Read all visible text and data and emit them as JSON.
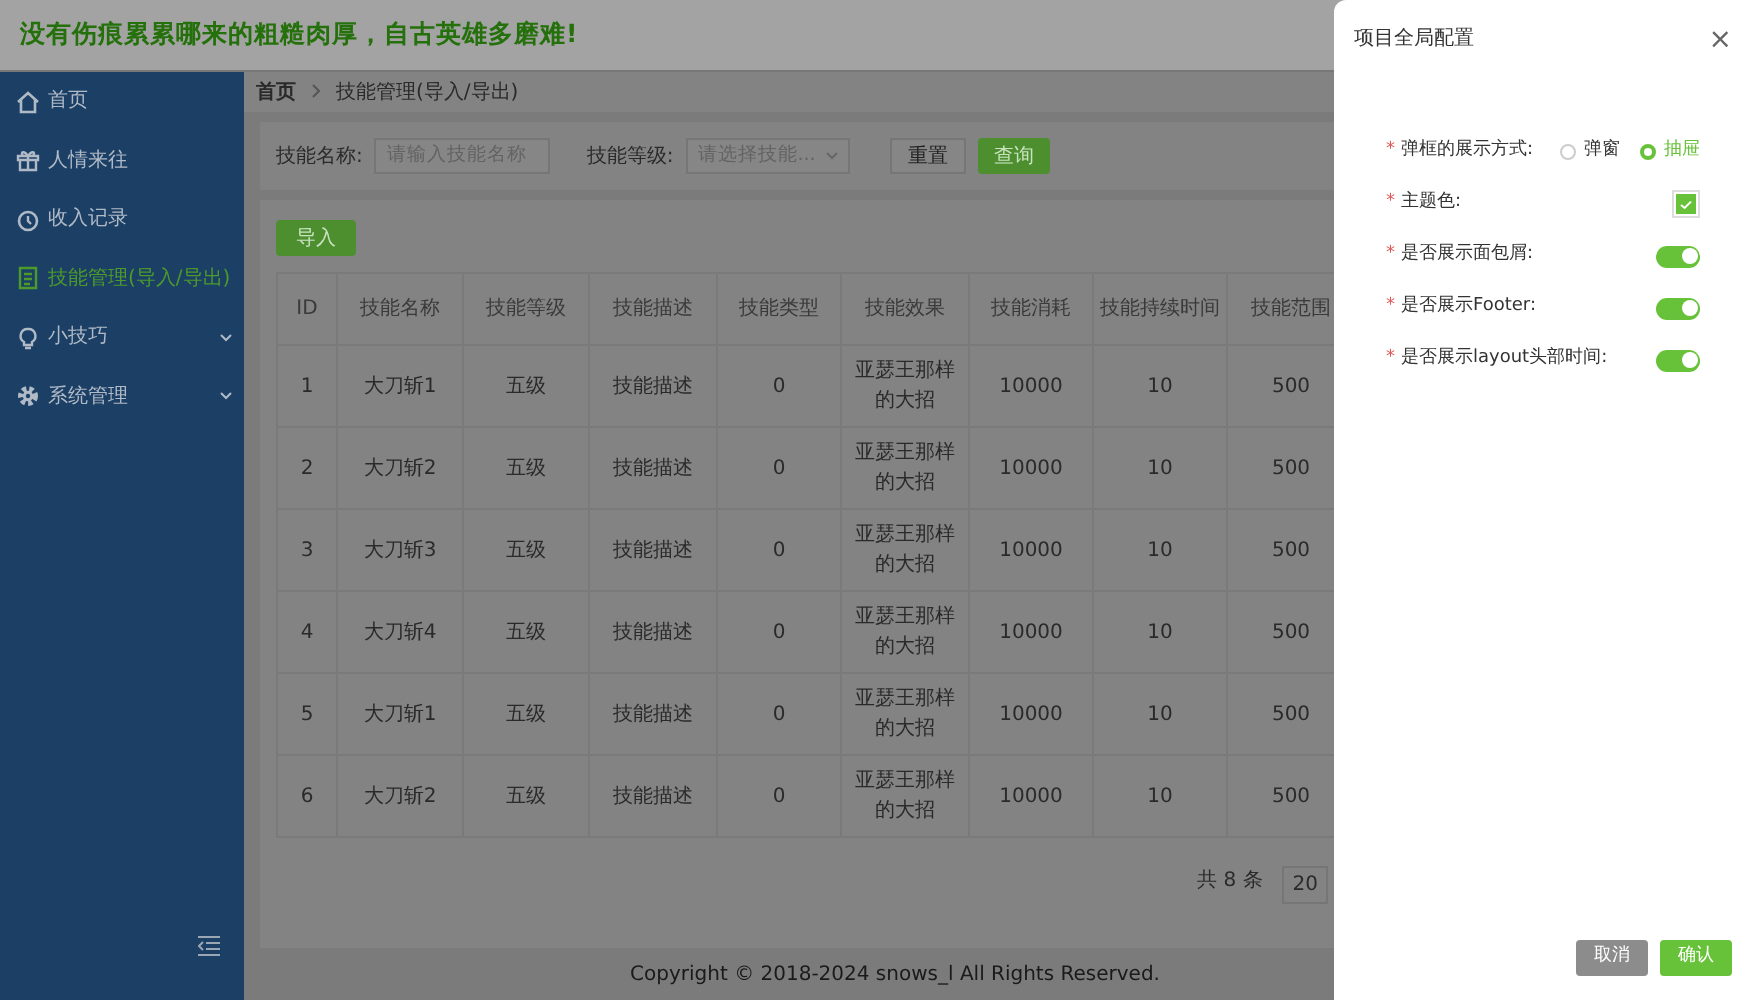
{
  "header": {
    "title": "没有伤痕累累哪来的粗糙肉厚，自古英雄多磨难!"
  },
  "sidebar": {
    "items": [
      {
        "label": "首页",
        "selected": false,
        "has_submenu": false
      },
      {
        "label": "人情来往",
        "selected": false,
        "has_submenu": false
      },
      {
        "label": "收入记录",
        "selected": false,
        "has_submenu": false
      },
      {
        "label": "技能管理(导入/导出)",
        "selected": true,
        "has_submenu": false
      },
      {
        "label": "小技巧",
        "selected": false,
        "has_submenu": true
      },
      {
        "label": "系统管理",
        "selected": false,
        "has_submenu": true
      }
    ]
  },
  "breadcrumb": [
    "首页",
    "技能管理(导入/导出)"
  ],
  "search": {
    "fields": [
      {
        "kind": "input",
        "label": "技能名称:",
        "placeholder": "请输入技能名称"
      },
      {
        "kind": "select",
        "label": "技能等级:",
        "placeholder": "请选择技能..."
      }
    ],
    "reset_button": "重置",
    "query_button": "查询"
  },
  "import_button": "导入",
  "table": {
    "columns": [
      "ID",
      "技能名称",
      "技能等级",
      "技能描述",
      "技能类型",
      "技能效果",
      "技能消耗",
      "技能持续时间",
      "技能范围"
    ],
    "rows": [
      [
        "1",
        "大刀斩1",
        "五级",
        "技能描述",
        "0",
        "亚瑟王那样的大招",
        "10000",
        "10",
        "500"
      ],
      [
        "2",
        "大刀斩2",
        "五级",
        "技能描述",
        "0",
        "亚瑟王那样的大招",
        "10000",
        "10",
        "500"
      ],
      [
        "3",
        "大刀斩3",
        "五级",
        "技能描述",
        "0",
        "亚瑟王那样的大招",
        "10000",
        "10",
        "500"
      ],
      [
        "4",
        "大刀斩4",
        "五级",
        "技能描述",
        "0",
        "亚瑟王那样的大招",
        "10000",
        "10",
        "500"
      ],
      [
        "5",
        "大刀斩1",
        "五级",
        "技能描述",
        "0",
        "亚瑟王那样的大招",
        "10000",
        "10",
        "500"
      ],
      [
        "6",
        "大刀斩2",
        "五级",
        "技能描述",
        "0",
        "亚瑟王那样的大招",
        "10000",
        "10",
        "500"
      ]
    ]
  },
  "pagination": {
    "total": "共 8 条",
    "page_size": "20"
  },
  "footer": {
    "copyright": "Copyright © 2018-2024 snows_l All Rights Reserved."
  },
  "drawer": {
    "title": "项目全局配置",
    "close": "×",
    "fields": [
      {
        "kind": "radio",
        "mark": "*",
        "label": "弹框的展示方式:",
        "options": [
          {
            "label": "弹窗",
            "selected": false
          },
          {
            "label": "抽屉",
            "selected": true
          }
        ]
      },
      {
        "kind": "color",
        "mark": "*",
        "label": "主题色:",
        "color": "#67c23a"
      },
      {
        "kind": "switch",
        "mark": "*",
        "label": "是否展示面包屑:",
        "on": true
      },
      {
        "kind": "switch",
        "mark": "*",
        "label": "是否展示Footer:",
        "on": true
      },
      {
        "kind": "switch",
        "mark": "*",
        "label": "是否展示layout头部时间:",
        "on": true
      }
    ],
    "cancel_button": "取消",
    "confirm_button": "确认"
  }
}
